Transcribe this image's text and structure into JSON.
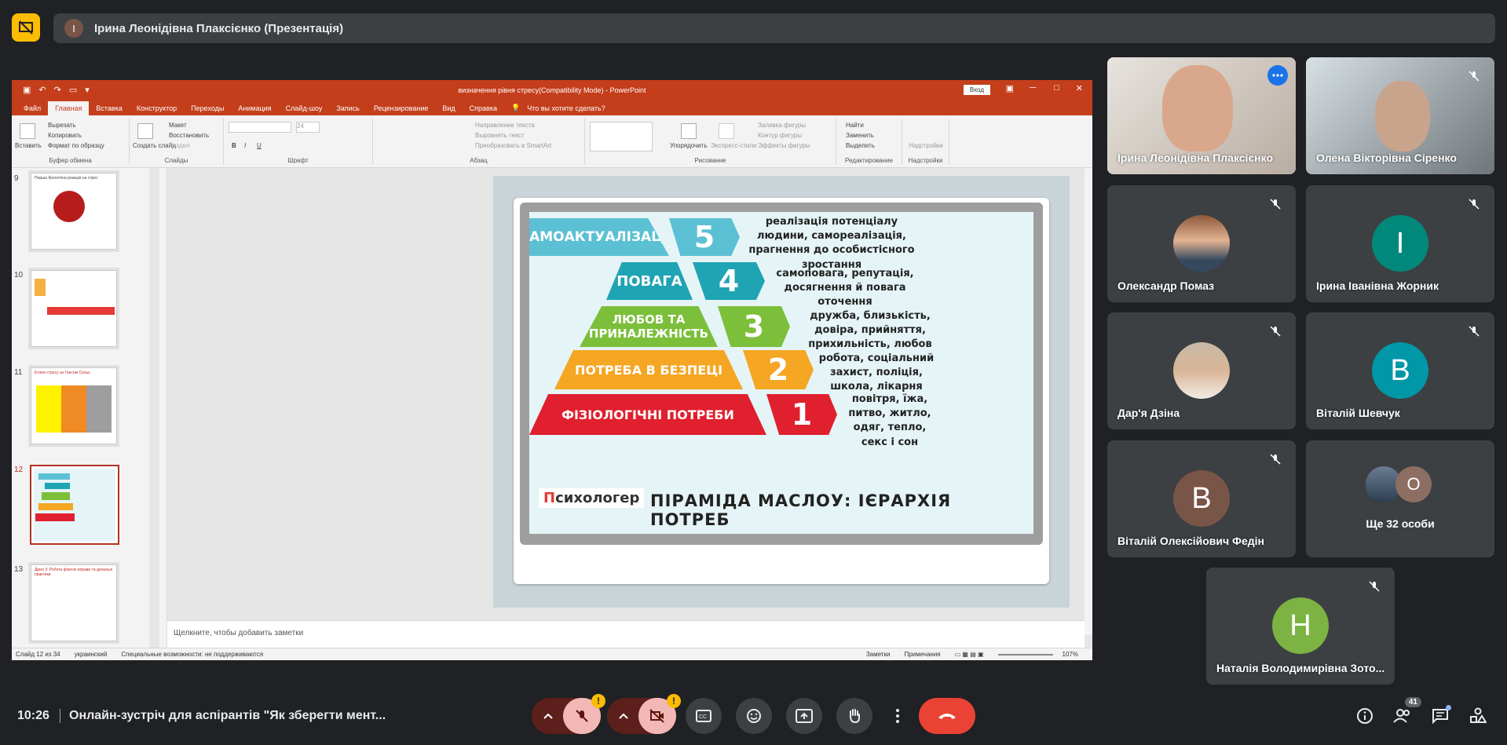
{
  "presenter_bar": {
    "avatar_letter": "І",
    "label": "Ірина Леонідівна Плаксієнко (Презентація)"
  },
  "ppt": {
    "title": "визначення рівня стресу(Compatibility Mode) - PowerPoint",
    "sign_in": "Вход",
    "tabs": [
      "Файл",
      "Главная",
      "Вставка",
      "Конструктор",
      "Переходы",
      "Анимация",
      "Слайд-шоу",
      "Запись",
      "Рецензирование",
      "Вид",
      "Справка"
    ],
    "active_tab": "Главная",
    "tell_me": "Что вы хотите сделать?",
    "ribbon": {
      "paste": "Вставить",
      "cut": "Вырезать",
      "copy": "Копировать",
      "format_painter": "Формат по образцу",
      "clipboard_group": "Буфер обмена",
      "new_slide": "Создать слайд",
      "layout": "Макет",
      "reset": "Восстановить",
      "section": "Раздел",
      "slides_group": "Слайды",
      "font_group": "Шрифт",
      "font_size": "24",
      "text_direction": "Направление текста",
      "align_text": "Выровнять текст",
      "smartart": "Преобразовать в SmartArt",
      "paragraph_group": "Абзац",
      "arrange": "Упорядочить",
      "quick_styles": "Экспресс-стили",
      "shape_fill": "Заливка фигуры",
      "shape_outline": "Контур фигуры",
      "shape_effects": "Эффекты фигуры",
      "drawing_group": "Рисование",
      "find": "Найти",
      "replace": "Заменить",
      "select": "Выделить",
      "editing_group": "Редактирование",
      "addins": "Надстройки",
      "addins_group": "Надстройки"
    },
    "thumbnails": [
      {
        "num": "9",
        "title": "Перша біологічна реакція на стрес"
      },
      {
        "num": "10",
        "title": ""
      },
      {
        "num": "11",
        "title": "Етапи стресу за Гансом Сельє"
      },
      {
        "num": "12",
        "title": ""
      },
      {
        "num": "13",
        "title": "Дрил 3: Робота фізичні вправи та дихальні практики"
      }
    ],
    "slide": {
      "tiers": [
        {
          "label": "САМОАКТУАЛІЗАЦІЯ",
          "num": "5",
          "desc": "реалізація потенціалу людини, самореалізація, прагнення до особистісного зростання",
          "color": "#5bc0d4"
        },
        {
          "label": "ПОВАГА",
          "num": "4",
          "desc": "самоповага, репутація, досягнення й повага оточення",
          "color": "#1fa4b4"
        },
        {
          "label": "ЛЮБОВ ТА ПРИНАЛЕЖНІСТЬ",
          "num": "3",
          "desc": "дружба, близькість, довіра, прийняття, прихильність, любов",
          "color": "#7bbf3a"
        },
        {
          "label": "ПОТРЕБА В БЕЗПЕЦІ",
          "num": "2",
          "desc": "робота, соціальний захист, поліція, школа, лікарня",
          "color": "#f5a623"
        },
        {
          "label": "ФІЗІОЛОГІЧНІ ПОТРЕБИ",
          "num": "1",
          "desc": "повітря, їжа, питво, житло, одяг, тепло, секс і сон",
          "color": "#e0202f"
        }
      ],
      "brand_p": "П",
      "brand_rest": "сихологер",
      "caption": "ПІРАМІДА МАСЛОУ: ІЄРАРХІЯ ПОТРЕБ"
    },
    "notes_placeholder": "Щелкните, чтобы добавить заметки",
    "status": {
      "slide_of": "Слайд 12 из 34",
      "language": "украинский",
      "accessibility": "Специальные возможности: не поддерживаются",
      "notes": "Заметки",
      "comments": "Примечания",
      "zoom": "107%"
    }
  },
  "participants": [
    {
      "name": "Ірина Леонідівна Плаксієнко",
      "type": "video",
      "active": true
    },
    {
      "name": "Олена Вікторівна Сіренко",
      "type": "video",
      "muted": true
    },
    {
      "name": "Олександр Помаз",
      "type": "photo",
      "muted": true
    },
    {
      "name": "Ірина Іванівна Жорник",
      "type": "letter",
      "letter": "І",
      "color": "#00897b",
      "muted": true
    },
    {
      "name": "Дар'я Дзіна",
      "type": "photo",
      "muted": true
    },
    {
      "name": "Віталій Шевчук",
      "type": "letter",
      "letter": "В",
      "color": "#0097a7",
      "muted": true
    },
    {
      "name": "Віталій Олексійович Федін",
      "type": "letter",
      "letter": "В",
      "color": "#795548",
      "muted": true
    },
    {
      "name": "Ще 32 особи",
      "type": "others",
      "letter": "О"
    },
    {
      "name": "Наталія Володимирівна Зото...",
      "type": "letter",
      "letter": "Н",
      "color": "#7cb342",
      "muted": true
    }
  ],
  "bottom": {
    "time": "10:26",
    "meeting_title": "Онлайн-зустріч для аспірантів \"Як зберегти мент...",
    "people_count": "41",
    "warn": "!"
  },
  "colors": {
    "ppt_accent": "#c43e1c",
    "meet_bg": "#202124",
    "tile_bg": "#3c4043",
    "end_call": "#ea4335",
    "warn": "#fbbc04"
  }
}
